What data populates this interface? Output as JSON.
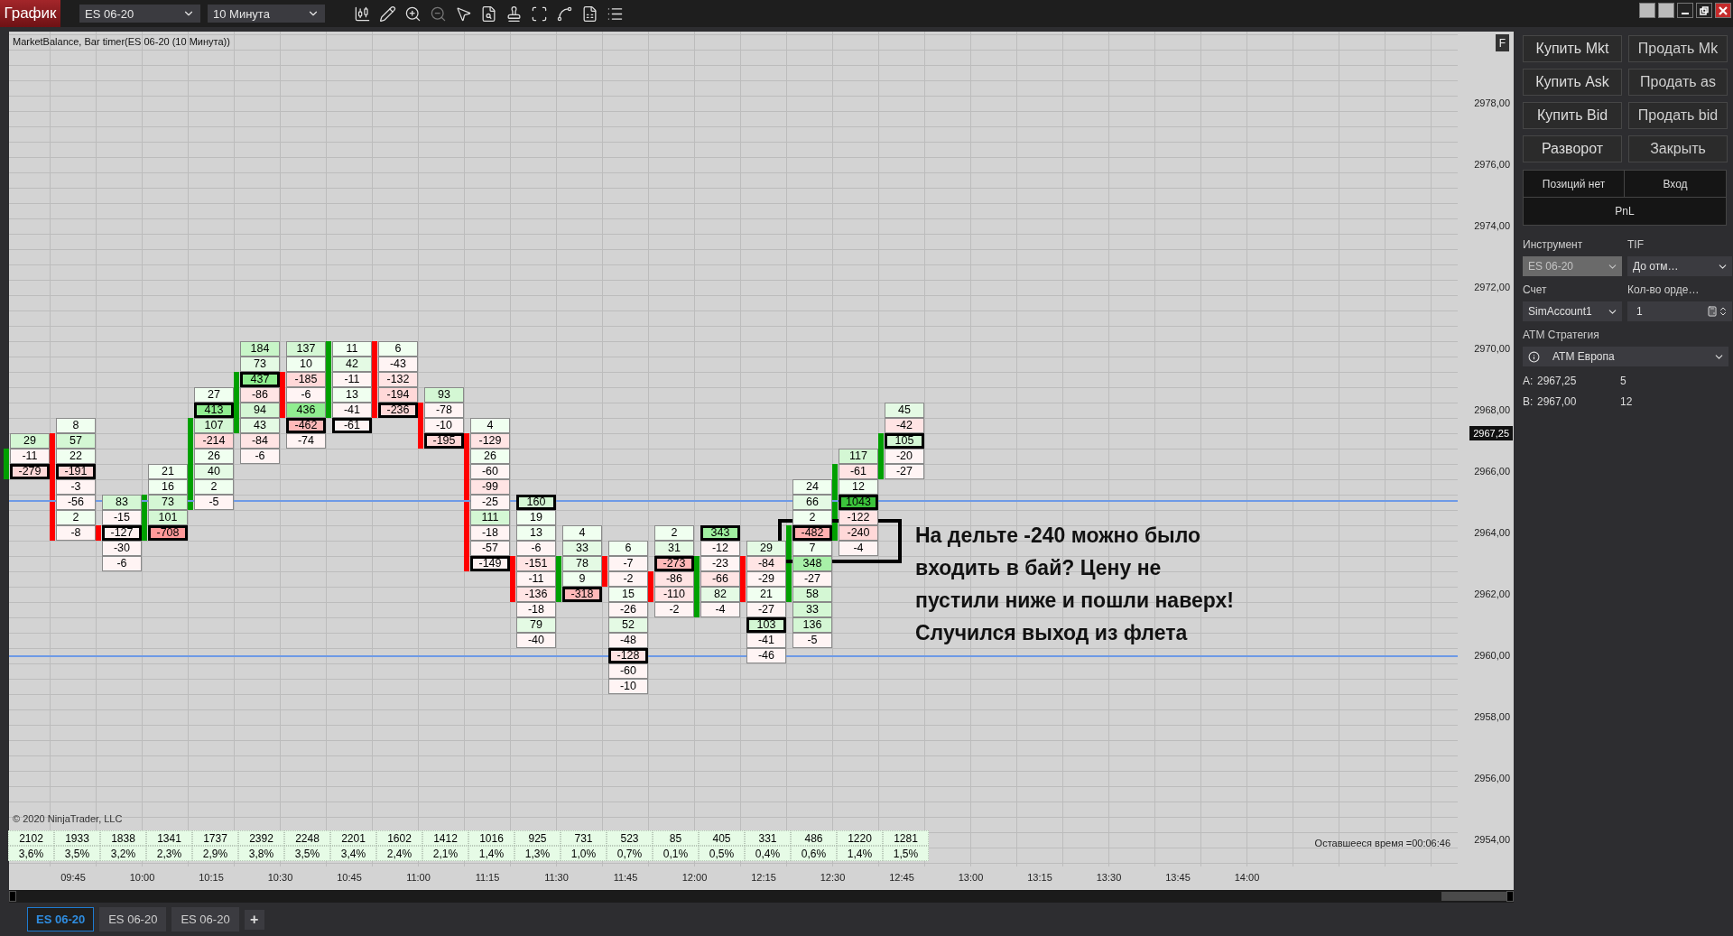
{
  "toolbar": {
    "title": "График",
    "instrument": "ES 06-20",
    "interval": "10 Минута"
  },
  "chart": {
    "title": "MarketBalance, Bar timer(ES 06-20 (10 Минута))",
    "f_button": "F",
    "columns": [
      {
        "color": "#00a000",
        "volume": "2102",
        "percent": "3,6%",
        "cells": [
          {
            "text": "29",
            "color": "#d4f7d4",
            "boxed": false,
            "bar": false
          },
          {
            "text": "-11",
            "color": "#fff4f4",
            "boxed": false,
            "bar": true
          },
          {
            "text": "-279",
            "color": "#ffd8d8",
            "boxed": true,
            "bar": true
          }
        ]
      },
      {
        "color": "#ff0000",
        "volume": "1933",
        "percent": "3,5%",
        "cells": [
          {
            "text": "8",
            "color": "#f0fff0",
            "boxed": false,
            "bar": false
          },
          {
            "text": "57",
            "color": "#d4f7d4",
            "boxed": false,
            "bar": true
          },
          {
            "text": "22",
            "color": "#f0fff0",
            "boxed": false,
            "bar": true
          },
          {
            "text": "-191",
            "color": "#ffd8d8",
            "boxed": true,
            "bar": true
          },
          {
            "text": "-3",
            "color": "#fff4f4",
            "boxed": false,
            "bar": true
          },
          {
            "text": "-56",
            "color": "#fff4f4",
            "boxed": false,
            "bar": true
          },
          {
            "text": "2",
            "color": "#f0fff0",
            "boxed": false,
            "bar": true
          },
          {
            "text": "-8",
            "color": "#fff4f4",
            "boxed": false,
            "bar": true
          }
        ]
      },
      {
        "color": "#ff0000",
        "volume": "1838",
        "percent": "3,2%",
        "cells": [
          {
            "text": "83",
            "color": "#d4f7d4",
            "boxed": false,
            "bar": false
          },
          {
            "text": "-15",
            "color": "#fff4f4",
            "boxed": false,
            "bar": false
          },
          {
            "text": "-127",
            "color": "#fff0f0",
            "boxed": true,
            "bar": true
          },
          {
            "text": "-30",
            "color": "#fff4f4",
            "boxed": false,
            "bar": false
          },
          {
            "text": "-6",
            "color": "#fff4f4",
            "boxed": false,
            "bar": false
          }
        ]
      },
      {
        "color": "#00a000",
        "volume": "1341",
        "percent": "2,3%",
        "cells": [
          {
            "text": "21",
            "color": "#f0fff0",
            "boxed": false,
            "bar": false
          },
          {
            "text": "16",
            "color": "#f0fff0",
            "boxed": false,
            "bar": false
          },
          {
            "text": "73",
            "color": "#d4f7d4",
            "boxed": false,
            "bar": true
          },
          {
            "text": "101",
            "color": "#d4f7d4",
            "boxed": false,
            "bar": true
          },
          {
            "text": "-708",
            "color": "#ff9a9a",
            "boxed": true,
            "bar": true
          }
        ]
      },
      {
        "color": "#00a000",
        "volume": "1737",
        "percent": "2,9%",
        "cells": [
          {
            "text": "27",
            "color": "#f0fff0",
            "boxed": false,
            "bar": false
          },
          {
            "text": "413",
            "color": "#90ee90",
            "boxed": true,
            "bar": false
          },
          {
            "text": "107",
            "color": "#d4f7d4",
            "boxed": false,
            "bar": true
          },
          {
            "text": "-214",
            "color": "#ffd8d8",
            "boxed": false,
            "bar": true
          },
          {
            "text": "26",
            "color": "#f0fff0",
            "boxed": false,
            "bar": true
          },
          {
            "text": "40",
            "color": "#e4fae4",
            "boxed": false,
            "bar": true
          },
          {
            "text": "2",
            "color": "#f0fff0",
            "boxed": false,
            "bar": true
          },
          {
            "text": "-5",
            "color": "#fff4f4",
            "boxed": false,
            "bar": true
          }
        ]
      },
      {
        "color": "#00a000",
        "volume": "2392",
        "percent": "3,8%",
        "cells": [
          {
            "text": "184",
            "color": "#c8f5c8",
            "boxed": false,
            "bar": false
          },
          {
            "text": "73",
            "color": "#e4fae4",
            "boxed": false,
            "bar": false
          },
          {
            "text": "437",
            "color": "#90ee90",
            "boxed": true,
            "bar": true
          },
          {
            "text": "-86",
            "color": "#ffe4e4",
            "boxed": false,
            "bar": true
          },
          {
            "text": "94",
            "color": "#d4f7d4",
            "boxed": false,
            "bar": true
          },
          {
            "text": "43",
            "color": "#e4fae4",
            "boxed": false,
            "bar": true
          },
          {
            "text": "-84",
            "color": "#ffe4e4",
            "boxed": false,
            "bar": false
          },
          {
            "text": "-6",
            "color": "#fff4f4",
            "boxed": false,
            "bar": false
          }
        ]
      },
      {
        "color": "#ff0000",
        "volume": "2248",
        "percent": "3,5%",
        "cells": [
          {
            "text": "137",
            "color": "#d4f7d4",
            "boxed": false,
            "bar": false
          },
          {
            "text": "10",
            "color": "#f0fff0",
            "boxed": false,
            "bar": false
          },
          {
            "text": "-185",
            "color": "#ffd8d8",
            "boxed": false,
            "bar": true
          },
          {
            "text": "-6",
            "color": "#fff4f4",
            "boxed": false,
            "bar": true
          },
          {
            "text": "436",
            "color": "#90ee90",
            "boxed": false,
            "bar": true
          },
          {
            "text": "-462",
            "color": "#ffb8b8",
            "boxed": true,
            "bar": false
          },
          {
            "text": "-74",
            "color": "#fff4f4",
            "boxed": false,
            "bar": false
          }
        ]
      },
      {
        "color": "#00a000",
        "volume": "2201",
        "percent": "3,4%",
        "cells": [
          {
            "text": "11",
            "color": "#f0fff0",
            "boxed": false,
            "bar": true
          },
          {
            "text": "42",
            "color": "#e4fae4",
            "boxed": false,
            "bar": true
          },
          {
            "text": "-11",
            "color": "#fff4f4",
            "boxed": false,
            "bar": true
          },
          {
            "text": "13",
            "color": "#f0fff0",
            "boxed": false,
            "bar": true
          },
          {
            "text": "-41",
            "color": "#fff4f4",
            "boxed": false,
            "bar": true
          },
          {
            "text": "-61",
            "color": "#fff4f4",
            "boxed": true,
            "bar": false
          }
        ]
      },
      {
        "color": "#ff0000",
        "volume": "1602",
        "percent": "2,4%",
        "cells": [
          {
            "text": "6",
            "color": "#f0fff0",
            "boxed": false,
            "bar": true
          },
          {
            "text": "-43",
            "color": "#fff4f4",
            "boxed": false,
            "bar": true
          },
          {
            "text": "-132",
            "color": "#ffe4e4",
            "boxed": false,
            "bar": true
          },
          {
            "text": "-194",
            "color": "#ffd8d8",
            "boxed": false,
            "bar": true
          },
          {
            "text": "-236",
            "color": "#ffd8d8",
            "boxed": true,
            "bar": true
          }
        ]
      },
      {
        "color": "#ff0000",
        "volume": "1412",
        "percent": "2,1%",
        "cells": [
          {
            "text": "93",
            "color": "#d4f7d4",
            "boxed": false,
            "bar": false
          },
          {
            "text": "-78",
            "color": "#fff4f4",
            "boxed": false,
            "bar": true
          },
          {
            "text": "-10",
            "color": "#fff4f4",
            "boxed": false,
            "bar": true
          },
          {
            "text": "-195",
            "color": "#ffd8d8",
            "boxed": true,
            "bar": true
          }
        ]
      },
      {
        "color": "#ff0000",
        "volume": "1016",
        "percent": "1,4%",
        "cells": [
          {
            "text": "4",
            "color": "#f0fff0",
            "boxed": false,
            "bar": false
          },
          {
            "text": "-129",
            "color": "#ffe4e4",
            "boxed": false,
            "bar": true
          },
          {
            "text": "26",
            "color": "#f0fff0",
            "boxed": false,
            "bar": true
          },
          {
            "text": "-60",
            "color": "#fff4f4",
            "boxed": false,
            "bar": true
          },
          {
            "text": "-99",
            "color": "#ffe4e4",
            "boxed": false,
            "bar": true
          },
          {
            "text": "-25",
            "color": "#fff4f4",
            "boxed": false,
            "bar": true
          },
          {
            "text": "111",
            "color": "#d4f7d4",
            "boxed": false,
            "bar": true
          },
          {
            "text": "-18",
            "color": "#fff4f4",
            "boxed": false,
            "bar": true
          },
          {
            "text": "-57",
            "color": "#fff4f4",
            "boxed": false,
            "bar": true
          },
          {
            "text": "-149",
            "color": "#fff0f0",
            "boxed": true,
            "bar": true
          }
        ]
      },
      {
        "color": "#ff0000",
        "volume": "925",
        "percent": "1,3%",
        "cells": [
          {
            "text": "160",
            "color": "#d4f7d4",
            "boxed": true,
            "bar": false
          },
          {
            "text": "19",
            "color": "#f0fff0",
            "boxed": false,
            "bar": false
          },
          {
            "text": "13",
            "color": "#f0fff0",
            "boxed": false,
            "bar": false
          },
          {
            "text": "-6",
            "color": "#fff4f4",
            "boxed": false,
            "bar": false
          },
          {
            "text": "-151",
            "color": "#ffe4e4",
            "boxed": false,
            "bar": true
          },
          {
            "text": "-11",
            "color": "#fff4f4",
            "boxed": false,
            "bar": true
          },
          {
            "text": "-136",
            "color": "#ffe4e4",
            "boxed": false,
            "bar": true
          },
          {
            "text": "-18",
            "color": "#fff4f4",
            "boxed": false,
            "bar": false
          },
          {
            "text": "79",
            "color": "#e4fae4",
            "boxed": false,
            "bar": false
          },
          {
            "text": "-40",
            "color": "#fff4f4",
            "boxed": false,
            "bar": false
          }
        ]
      },
      {
        "color": "#00a000",
        "volume": "731",
        "percent": "1,0%",
        "cells": [
          {
            "text": "4",
            "color": "#f0fff0",
            "boxed": false,
            "bar": false
          },
          {
            "text": "33",
            "color": "#e4fae4",
            "boxed": false,
            "bar": false
          },
          {
            "text": "78",
            "color": "#e4fae4",
            "boxed": false,
            "bar": true
          },
          {
            "text": "9",
            "color": "#f0fff0",
            "boxed": false,
            "bar": true
          },
          {
            "text": "-318",
            "color": "#ffb8b8",
            "boxed": true,
            "bar": true
          }
        ]
      },
      {
        "color": "#ff0000",
        "volume": "523",
        "percent": "0,7%",
        "cells": [
          {
            "text": "6",
            "color": "#f0fff0",
            "boxed": false,
            "bar": false
          },
          {
            "text": "-7",
            "color": "#fff4f4",
            "boxed": false,
            "bar": true
          },
          {
            "text": "-2",
            "color": "#fff4f4",
            "boxed": false,
            "bar": true
          },
          {
            "text": "15",
            "color": "#f0fff0",
            "boxed": false,
            "bar": false
          },
          {
            "text": "-26",
            "color": "#fff4f4",
            "boxed": false,
            "bar": false
          },
          {
            "text": "52",
            "color": "#e4fae4",
            "boxed": false,
            "bar": false
          },
          {
            "text": "-48",
            "color": "#fff4f4",
            "boxed": false,
            "bar": false
          },
          {
            "text": "-128",
            "color": "#ffe4e4",
            "boxed": true,
            "bar": false
          },
          {
            "text": "-60",
            "color": "#fff4f4",
            "boxed": false,
            "bar": false
          },
          {
            "text": "-10",
            "color": "#fff4f4",
            "boxed": false,
            "bar": false
          }
        ]
      },
      {
        "color": "#ff0000",
        "volume": "85",
        "percent": "0,1%",
        "cells": [
          {
            "text": "2",
            "color": "#f0fff0",
            "boxed": false,
            "bar": false
          },
          {
            "text": "31",
            "color": "#e4fae4",
            "boxed": false,
            "bar": false
          },
          {
            "text": "-273",
            "color": "#ffb8b8",
            "boxed": true,
            "bar": false
          },
          {
            "text": "-86",
            "color": "#ffe4e4",
            "boxed": false,
            "bar": true
          },
          {
            "text": "-110",
            "color": "#ffe4e4",
            "boxed": false,
            "bar": true
          },
          {
            "text": "-2",
            "color": "#fff4f4",
            "boxed": false,
            "bar": false
          }
        ]
      },
      {
        "color": "#00a000",
        "volume": "405",
        "percent": "0,5%",
        "cells": [
          {
            "text": "343",
            "color": "#a0f0a0",
            "boxed": true,
            "bar": false
          },
          {
            "text": "-12",
            "color": "#fff4f4",
            "boxed": false,
            "bar": false
          },
          {
            "text": "-23",
            "color": "#fff4f4",
            "boxed": false,
            "bar": true
          },
          {
            "text": "-66",
            "color": "#ffe4e4",
            "boxed": false,
            "bar": true
          },
          {
            "text": "82",
            "color": "#e4fae4",
            "boxed": false,
            "bar": true
          },
          {
            "text": "-4",
            "color": "#fff4f4",
            "boxed": false,
            "bar": true
          }
        ]
      },
      {
        "color": "#ff0000",
        "volume": "331",
        "percent": "0,4%",
        "cells": [
          {
            "text": "29",
            "color": "#e4fae4",
            "boxed": false,
            "bar": false
          },
          {
            "text": "-84",
            "color": "#ffe4e4",
            "boxed": false,
            "bar": true
          },
          {
            "text": "-29",
            "color": "#fff4f4",
            "boxed": false,
            "bar": true
          },
          {
            "text": "21",
            "color": "#f0fff0",
            "boxed": false,
            "bar": true
          },
          {
            "text": "-27",
            "color": "#fff4f4",
            "boxed": false,
            "bar": false
          },
          {
            "text": "103",
            "color": "#d4f7d4",
            "boxed": true,
            "bar": false
          },
          {
            "text": "-41",
            "color": "#fff4f4",
            "boxed": false,
            "bar": false
          },
          {
            "text": "-46",
            "color": "#fff4f4",
            "boxed": false,
            "bar": false
          }
        ]
      },
      {
        "color": "#00a000",
        "volume": "486",
        "percent": "0,6%",
        "cells": [
          {
            "text": "24",
            "color": "#f0fff0",
            "boxed": false,
            "bar": false
          },
          {
            "text": "66",
            "color": "#e4fae4",
            "boxed": false,
            "bar": false
          },
          {
            "text": "2",
            "color": "#f0fff0",
            "boxed": false,
            "bar": false
          },
          {
            "text": "-482",
            "color": "#ffb0b0",
            "boxed": true,
            "bar": true
          },
          {
            "text": "7",
            "color": "#f0fff0",
            "boxed": false,
            "bar": true
          },
          {
            "text": "348",
            "color": "#a8f0a8",
            "boxed": false,
            "bar": true
          },
          {
            "text": "-27",
            "color": "#fff4f4",
            "boxed": false,
            "bar": true
          },
          {
            "text": "58",
            "color": "#d4f7d4",
            "boxed": false,
            "bar": true
          },
          {
            "text": "33",
            "color": "#d4f7d4",
            "boxed": false,
            "bar": false
          },
          {
            "text": "136",
            "color": "#d4f7d4",
            "boxed": false,
            "bar": false
          },
          {
            "text": "-5",
            "color": "#fff4f4",
            "boxed": false,
            "bar": false
          }
        ]
      },
      {
        "color": "#00a000",
        "volume": "1220",
        "percent": "1,4%",
        "cells": [
          {
            "text": "117",
            "color": "#d4f7d4",
            "boxed": false,
            "bar": false
          },
          {
            "text": "-61",
            "color": "#ffe4e4",
            "boxed": false,
            "bar": true
          },
          {
            "text": "12",
            "color": "#f0fff0",
            "boxed": false,
            "bar": true
          },
          {
            "text": "1043",
            "color": "#3cc43c",
            "boxed": true,
            "bar": true
          },
          {
            "text": "-122",
            "color": "#ffe4e4",
            "boxed": false,
            "bar": true
          },
          {
            "text": "-240",
            "color": "#ffd8d8",
            "boxed": false,
            "bar": true
          },
          {
            "text": "-4",
            "color": "#fff4f4",
            "boxed": false,
            "bar": false
          }
        ]
      },
      {
        "color": "#00a000",
        "volume": "1281",
        "percent": "1,5%",
        "cells": [
          {
            "text": "45",
            "color": "#e4fae4",
            "boxed": false,
            "bar": false
          },
          {
            "text": "-42",
            "color": "#ffe4e4",
            "boxed": false,
            "bar": false
          },
          {
            "text": "105",
            "color": "#d4f7d4",
            "boxed": true,
            "bar": true
          },
          {
            "text": "-20",
            "color": "#fff4f4",
            "boxed": false,
            "bar": true
          },
          {
            "text": "-27",
            "color": "#fff4f4",
            "boxed": false,
            "bar": true
          }
        ]
      }
    ],
    "copyright": "© 2020 NinjaTrader, LLC",
    "timer": "Оставшееся время =00:06:46",
    "price_axis": [
      "2978,00",
      "2976,00",
      "2974,00",
      "2972,00",
      "2970,00",
      "2968,00",
      "2966,00",
      "2964,00",
      "2962,00",
      "2960,00",
      "2958,00",
      "2956,00",
      "2954,00"
    ],
    "current_price": "2967,25",
    "time_axis": [
      "09:45",
      "10:00",
      "10:15",
      "10:30",
      "10:45",
      "11:00",
      "11:15",
      "11:30",
      "11:45",
      "12:00",
      "12:15",
      "12:30",
      "12:45",
      "13:00",
      "13:15",
      "13:30",
      "13:45",
      "14:00"
    ],
    "annotation": "На дельте -240 можно было\nвходить в бай? Цену не\nпустили ниже и пошли наверх!\nСлучился выход из флета"
  },
  "tabs": [
    {
      "label": "ES 06-20",
      "selected": true
    },
    {
      "label": "ES 06-20",
      "selected": false
    },
    {
      "label": "ES 06-20",
      "selected": false
    }
  ],
  "add_tab": "+",
  "panel": {
    "buttons": [
      "Купить Mkt",
      "Продать Mk",
      "Купить Ask",
      "Продать as",
      "Купить Bid",
      "Продать bid",
      "Разворот",
      "Закрыть"
    ],
    "position": {
      "status": "Позиций нет",
      "entry": "Вход",
      "pnl": "PnL"
    },
    "instrument_label": "Инструмент",
    "tif_label": "TIF",
    "instrument": {
      "value": "ES 06-20",
      "disabled": true
    },
    "tif": "До отм…",
    "account_label": "Счет",
    "qty_label": "Кол-во орде…",
    "account": "SimAccount1",
    "qty": "1",
    "atm_label": "ATM Стратегия",
    "atm": "ATM Европа",
    "quotes": [
      {
        "label": "A:",
        "price": "2967,25",
        "size": "5"
      },
      {
        "label": "B:",
        "price": "2967,00",
        "size": "12"
      }
    ]
  }
}
